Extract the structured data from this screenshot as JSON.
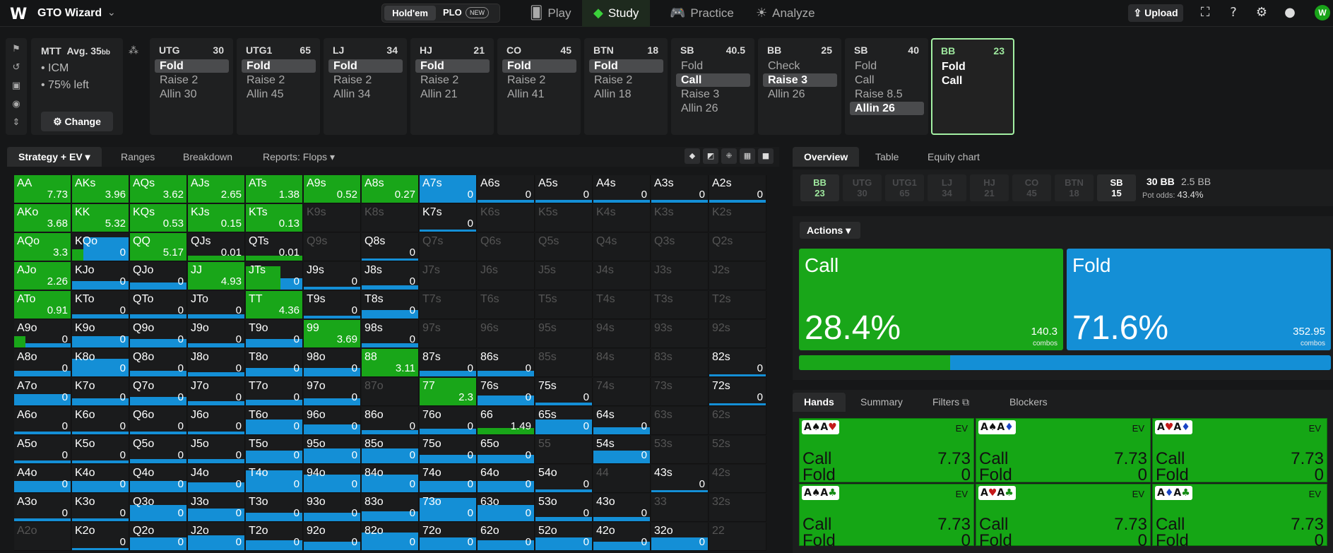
{
  "topbar": {
    "brand": "GTO Wizard",
    "holdem": "Hold'em",
    "plo": "PLO",
    "plo_badge": "NEW",
    "nav": [
      {
        "label": "Play",
        "icon": "cards-icon"
      },
      {
        "label": "Study",
        "icon": "graduation-cap-icon"
      },
      {
        "label": "Practice",
        "icon": "gamepad-icon"
      },
      {
        "label": "Analyze",
        "icon": "lightbulb-icon"
      }
    ],
    "active_nav": "Study",
    "upload": "Upload"
  },
  "spot": {
    "format": "MTT",
    "avg_label": "Avg. 35",
    "avg_unit": "bb",
    "lines": [
      "• ICM",
      "• 75% left"
    ],
    "change": "Change"
  },
  "positions": [
    {
      "name": "UTG",
      "stack": "30",
      "actions": [
        "Fold",
        "Raise 2",
        "Allin 30"
      ],
      "selected": "Fold"
    },
    {
      "name": "UTG1",
      "stack": "65",
      "actions": [
        "Fold",
        "Raise 2",
        "Allin 45"
      ],
      "selected": "Fold"
    },
    {
      "name": "LJ",
      "stack": "34",
      "actions": [
        "Fold",
        "Raise 2",
        "Allin 34"
      ],
      "selected": "Fold"
    },
    {
      "name": "HJ",
      "stack": "21",
      "actions": [
        "Fold",
        "Raise 2",
        "Allin 21"
      ],
      "selected": "Fold"
    },
    {
      "name": "CO",
      "stack": "45",
      "actions": [
        "Fold",
        "Raise 2",
        "Allin 41"
      ],
      "selected": "Fold"
    },
    {
      "name": "BTN",
      "stack": "18",
      "actions": [
        "Fold",
        "Raise 2",
        "Allin 18"
      ],
      "selected": "Fold"
    },
    {
      "name": "SB",
      "stack": "40.5",
      "actions": [
        "Fold",
        "Call",
        "Raise 3",
        "Allin 26"
      ],
      "selected": "Call"
    },
    {
      "name": "BB",
      "stack": "25",
      "actions": [
        "Check",
        "Raise 3",
        "Allin 26"
      ],
      "selected": "Raise 3"
    },
    {
      "name": "SB",
      "stack": "40",
      "actions": [
        "Fold",
        "Call",
        "Raise 8.5",
        "Allin 26"
      ],
      "selected": "Allin 26"
    },
    {
      "name": "BB",
      "stack": "23",
      "actions": [
        "Fold",
        "Call"
      ],
      "selected": "",
      "current": true
    }
  ],
  "strategy_tabs": {
    "active": "Strategy + EV",
    "others": [
      "Ranges",
      "Breakdown",
      "Reports: Flops"
    ]
  },
  "right_tabs": [
    "Overview",
    "Table",
    "Equity chart"
  ],
  "seats": [
    {
      "name": "BB",
      "stack": "23",
      "state": "bb"
    },
    {
      "name": "UTG",
      "stack": "30",
      "state": "off"
    },
    {
      "name": "UTG1",
      "stack": "65",
      "state": "off"
    },
    {
      "name": "LJ",
      "stack": "34",
      "state": "off"
    },
    {
      "name": "HJ",
      "stack": "21",
      "state": "off"
    },
    {
      "name": "CO",
      "stack": "45",
      "state": "off"
    },
    {
      "name": "BTN",
      "stack": "18",
      "state": "off"
    },
    {
      "name": "SB",
      "stack": "15",
      "state": "on"
    }
  ],
  "pot": {
    "bb": "30 BB",
    "bb2": "2.5 BB",
    "odds_label": "Pot odds:",
    "odds": "43.4%"
  },
  "actions_label": "Actions",
  "action_summary": [
    {
      "name": "Call",
      "pct": "28.4%",
      "combos": "140.3",
      "unit": "combos",
      "color": "#19a619",
      "freq": 0.284
    },
    {
      "name": "Fold",
      "pct": "71.6%",
      "combos": "352.95",
      "unit": "combos",
      "color": "#148fd6",
      "freq": 0.716
    }
  ],
  "hands_tabs": [
    "Hands",
    "Summary",
    "Filters",
    "Blockers"
  ],
  "hands": [
    {
      "cards": [
        [
          "A",
          "♠",
          "sblk"
        ],
        [
          "A",
          "♥",
          "sred"
        ]
      ],
      "ev_label": "EV",
      "call": "Call",
      "call_ev": "7.73",
      "fold": "Fold",
      "fold_ev": "0"
    },
    {
      "cards": [
        [
          "A",
          "♠",
          "sblk"
        ],
        [
          "A",
          "♦",
          "sblu"
        ]
      ],
      "ev_label": "EV",
      "call": "Call",
      "call_ev": "7.73",
      "fold": "Fold",
      "fold_ev": "0"
    },
    {
      "cards": [
        [
          "A",
          "♥",
          "sred"
        ],
        [
          "A",
          "♦",
          "sblu"
        ]
      ],
      "ev_label": "EV",
      "call": "Call",
      "call_ev": "7.73",
      "fold": "Fold",
      "fold_ev": "0"
    },
    {
      "cards": [
        [
          "A",
          "♠",
          "sblk"
        ],
        [
          "A",
          "♣",
          "sgrn"
        ]
      ],
      "ev_label": "EV",
      "call": "Call",
      "call_ev": "7.73",
      "fold": "Fold",
      "fold_ev": "0"
    },
    {
      "cards": [
        [
          "A",
          "♥",
          "sred"
        ],
        [
          "A",
          "♣",
          "sgrn"
        ]
      ],
      "ev_label": "EV",
      "call": "Call",
      "call_ev": "7.73",
      "fold": "Fold",
      "fold_ev": "0"
    },
    {
      "cards": [
        [
          "A",
          "♦",
          "sblu"
        ],
        [
          "A",
          "♣",
          "sgrn"
        ]
      ],
      "ev_label": "EV",
      "call": "Call",
      "call_ev": "7.73",
      "fold": "Fold",
      "fold_ev": "0"
    }
  ],
  "colors": {
    "call": "#19a619",
    "fold": "#148fd6"
  },
  "grid": [
    [
      [
        "AA",
        "7.73",
        1,
        0
      ],
      [
        "AKs",
        "3.96",
        1,
        0
      ],
      [
        "AQs",
        "3.62",
        1,
        0
      ],
      [
        "AJs",
        "2.65",
        1,
        0
      ],
      [
        "ATs",
        "1.38",
        1,
        0
      ],
      [
        "A9s",
        "0.52",
        1,
        0
      ],
      [
        "A8s",
        "0.27",
        1,
        0
      ],
      [
        "A7s",
        "0",
        0,
        1
      ],
      [
        "A6s",
        "0",
        0,
        0.1
      ],
      [
        "A5s",
        "0",
        0,
        0.05
      ],
      [
        "A4s",
        "0",
        0,
        0.05
      ],
      [
        "A3s",
        "0",
        0,
        0.05
      ],
      [
        "A2s",
        "0",
        0,
        0.05
      ]
    ],
    [
      [
        "AKo",
        "3.68",
        1,
        0
      ],
      [
        "KK",
        "5.32",
        1,
        0
      ],
      [
        "KQs",
        "0.53",
        1,
        0
      ],
      [
        "KJs",
        "0.15",
        1,
        0
      ],
      [
        "KTs",
        "0.13",
        1,
        0
      ],
      [
        "K9s",
        "",
        0,
        0,
        1
      ],
      [
        "K8s",
        "",
        0,
        0,
        1
      ],
      [
        "K7s",
        "0",
        0,
        0
      ],
      [
        "K6s",
        "",
        0,
        0,
        1
      ],
      [
        "K5s",
        "",
        0,
        0,
        1
      ],
      [
        "K4s",
        "",
        0,
        0,
        1
      ],
      [
        "K3s",
        "",
        0,
        0,
        1
      ],
      [
        "K2s",
        "",
        0,
        0,
        1
      ]
    ],
    [
      [
        "AQo",
        "3.3",
        1,
        0
      ],
      [
        "KQo",
        "0",
        0.2,
        0.8
      ],
      [
        "QQ",
        "5.17",
        1,
        0
      ],
      [
        "QJs",
        "0.01",
        0.35,
        0
      ],
      [
        "QTs",
        "0.01",
        0.3,
        0
      ],
      [
        "Q9s",
        "",
        0,
        0,
        1
      ],
      [
        "Q8s",
        "0",
        0,
        0
      ],
      [
        "Q7s",
        "",
        0,
        0,
        1
      ],
      [
        "Q6s",
        "",
        0,
        0,
        1
      ],
      [
        "Q5s",
        "",
        0,
        0,
        1
      ],
      [
        "Q4s",
        "",
        0,
        0,
        1
      ],
      [
        "Q3s",
        "",
        0,
        0,
        1
      ],
      [
        "Q2s",
        "",
        0,
        0,
        1
      ]
    ],
    [
      [
        "AJo",
        "2.26",
        1,
        0
      ],
      [
        "KJo",
        "0",
        0,
        0.3
      ],
      [
        "QJo",
        "0",
        0,
        0.25
      ],
      [
        "JJ",
        "4.93",
        1,
        0
      ],
      [
        "JTs",
        "0",
        0.6,
        0.4
      ],
      [
        "J9s",
        "0",
        0,
        0.1
      ],
      [
        "J8s",
        "0",
        0,
        0.15
      ],
      [
        "J7s",
        "",
        0,
        0,
        1
      ],
      [
        "J6s",
        "",
        0,
        0,
        1
      ],
      [
        "J5s",
        "",
        0,
        0,
        1
      ],
      [
        "J4s",
        "",
        0,
        0,
        1
      ],
      [
        "J3s",
        "",
        0,
        0,
        1
      ],
      [
        "J2s",
        "",
        0,
        0,
        1
      ]
    ],
    [
      [
        "ATo",
        "0.91",
        1,
        0
      ],
      [
        "KTo",
        "0",
        0,
        0.15
      ],
      [
        "QTo",
        "0",
        0,
        0.15
      ],
      [
        "JTo",
        "0",
        0,
        0.15
      ],
      [
        "TT",
        "4.36",
        1,
        0
      ],
      [
        "T9s",
        "0",
        0,
        0.1
      ],
      [
        "T8s",
        "0",
        0,
        0.3
      ],
      [
        "T7s",
        "",
        0,
        0,
        1
      ],
      [
        "T6s",
        "",
        0,
        0,
        1
      ],
      [
        "T5s",
        "",
        0,
        0,
        1
      ],
      [
        "T4s",
        "",
        0,
        0,
        1
      ],
      [
        "T3s",
        "",
        0,
        0,
        1
      ],
      [
        "T2s",
        "",
        0,
        0,
        1
      ]
    ],
    [
      [
        "A9o",
        "0",
        0.2,
        0.15
      ],
      [
        "K9o",
        "0",
        0,
        0.4
      ],
      [
        "Q9o",
        "0",
        0,
        0.3
      ],
      [
        "J9o",
        "0",
        0,
        0.15
      ],
      [
        "T9o",
        "0",
        0,
        0.3
      ],
      [
        "99",
        "3.69",
        1,
        0
      ],
      [
        "98s",
        "0",
        0,
        0.15
      ],
      [
        "97s",
        "",
        0,
        0,
        1
      ],
      [
        "96s",
        "",
        0,
        0,
        1
      ],
      [
        "95s",
        "",
        0,
        0,
        1
      ],
      [
        "94s",
        "",
        0,
        0,
        1
      ],
      [
        "93s",
        "",
        0,
        0,
        1
      ],
      [
        "92s",
        "",
        0,
        0,
        1
      ]
    ],
    [
      [
        "A8o",
        "0",
        0,
        0.2
      ],
      [
        "K8o",
        "0",
        0,
        0.6
      ],
      [
        "Q8o",
        "0",
        0,
        0.2
      ],
      [
        "J8o",
        "0",
        0,
        0.15
      ],
      [
        "T8o",
        "0",
        0,
        0.3
      ],
      [
        "98o",
        "0",
        0,
        0.3
      ],
      [
        "88",
        "3.11",
        1,
        0
      ],
      [
        "87s",
        "0",
        0,
        0.2
      ],
      [
        "86s",
        "0",
        0,
        0.2
      ],
      [
        "85s",
        "",
        0,
        0,
        1
      ],
      [
        "84s",
        "",
        0,
        0,
        1
      ],
      [
        "83s",
        "",
        0,
        0,
        1
      ],
      [
        "82s",
        "0",
        0,
        0
      ]
    ],
    [
      [
        "A7o",
        "0",
        0,
        0.4
      ],
      [
        "K7o",
        "0",
        0,
        0.25
      ],
      [
        "Q7o",
        "0",
        0,
        0.3
      ],
      [
        "J7o",
        "0",
        0,
        0.15
      ],
      [
        "T7o",
        "0",
        0,
        0.2
      ],
      [
        "97o",
        "0",
        0,
        0.25
      ],
      [
        "87o",
        "",
        0,
        0,
        1
      ],
      [
        "77",
        "2.3",
        1,
        0
      ],
      [
        "76s",
        "0",
        0,
        0.35
      ],
      [
        "75s",
        "0",
        0,
        0.05
      ],
      [
        "74s",
        "",
        0,
        0,
        1
      ],
      [
        "73s",
        "",
        0,
        0,
        1
      ],
      [
        "72s",
        "0",
        0,
        0
      ]
    ],
    [
      [
        "A6o",
        "0",
        0,
        0.1
      ],
      [
        "K6o",
        "0",
        0,
        0.1
      ],
      [
        "Q6o",
        "0",
        0,
        0.1
      ],
      [
        "J6o",
        "0",
        0,
        0.1
      ],
      [
        "T6o",
        "0",
        0,
        0.5
      ],
      [
        "96o",
        "0",
        0,
        0.35
      ],
      [
        "86o",
        "0",
        0,
        0.15
      ],
      [
        "76o",
        "0",
        0,
        0.2
      ],
      [
        "66",
        "1.49",
        0.2,
        0
      ],
      [
        "65s",
        "0",
        0,
        0.5
      ],
      [
        "64s",
        "0",
        0,
        0.25
      ],
      [
        "63s",
        "",
        0,
        0,
        1
      ],
      [
        "62s",
        "",
        0,
        0,
        1
      ]
    ],
    [
      [
        "A5o",
        "0",
        0,
        0.1
      ],
      [
        "K5o",
        "0",
        0,
        0.1
      ],
      [
        "Q5o",
        "0",
        0,
        0.15
      ],
      [
        "J5o",
        "0",
        0,
        0.15
      ],
      [
        "T5o",
        "0",
        0,
        0.45
      ],
      [
        "95o",
        "0",
        0,
        0.5
      ],
      [
        "85o",
        "0",
        0,
        0.5
      ],
      [
        "75o",
        "0",
        0,
        0.3
      ],
      [
        "65o",
        "0",
        0,
        0.3
      ],
      [
        "55",
        "",
        0,
        0,
        1
      ],
      [
        "54s",
        "0",
        0,
        0.45
      ],
      [
        "53s",
        "",
        0,
        0,
        1
      ],
      [
        "52s",
        "",
        0,
        0,
        1
      ]
    ],
    [
      [
        "A4o",
        "0",
        0,
        0.4
      ],
      [
        "K4o",
        "0",
        0,
        0.4
      ],
      [
        "Q4o",
        "0",
        0,
        0.4
      ],
      [
        "J4o",
        "0",
        0,
        0.35
      ],
      [
        "T4o",
        "0",
        0,
        0.75
      ],
      [
        "94o",
        "0",
        0,
        0.6
      ],
      [
        "84o",
        "0",
        0,
        0.6
      ],
      [
        "74o",
        "0",
        0,
        0.4
      ],
      [
        "64o",
        "0",
        0,
        0.4
      ],
      [
        "54o",
        "0",
        0,
        0.05
      ],
      [
        "44",
        "",
        0,
        0,
        1
      ],
      [
        "43s",
        "0",
        0,
        0
      ],
      [
        "42s",
        "",
        0,
        0,
        1
      ]
    ],
    [
      [
        "A3o",
        "0",
        0,
        0.1
      ],
      [
        "K3o",
        "0",
        0,
        0.1
      ],
      [
        "Q3o",
        "0",
        0,
        0.55
      ],
      [
        "J3o",
        "0",
        0,
        0.45
      ],
      [
        "T3o",
        "0",
        0,
        0.3
      ],
      [
        "93o",
        "0",
        0,
        0.3
      ],
      [
        "83o",
        "0",
        0,
        0.35
      ],
      [
        "73o",
        "0",
        0,
        0.8
      ],
      [
        "63o",
        "0",
        0,
        0.55
      ],
      [
        "53o",
        "0",
        0,
        0.15
      ],
      [
        "43o",
        "0",
        0,
        0.15
      ],
      [
        "33",
        "",
        0,
        0,
        1
      ],
      [
        "32s",
        "",
        0,
        0,
        1
      ]
    ],
    [
      [
        "A2o",
        "",
        0,
        0,
        1
      ],
      [
        "K2o",
        "0",
        0,
        0
      ],
      [
        "Q2o",
        "0",
        0,
        0.45
      ],
      [
        "J2o",
        "0",
        0,
        0.5
      ],
      [
        "T2o",
        "0",
        0,
        0.35
      ],
      [
        "92o",
        "0",
        0,
        0.3
      ],
      [
        "82o",
        "0",
        0,
        0.6
      ],
      [
        "72o",
        "0",
        0,
        0.45
      ],
      [
        "62o",
        "0",
        0,
        0.35
      ],
      [
        "52o",
        "0",
        0,
        0.45
      ],
      [
        "42o",
        "0",
        0,
        0.3
      ],
      [
        "32o",
        "0",
        0,
        0.45
      ],
      [
        "22",
        "",
        0,
        0,
        1
      ]
    ]
  ]
}
